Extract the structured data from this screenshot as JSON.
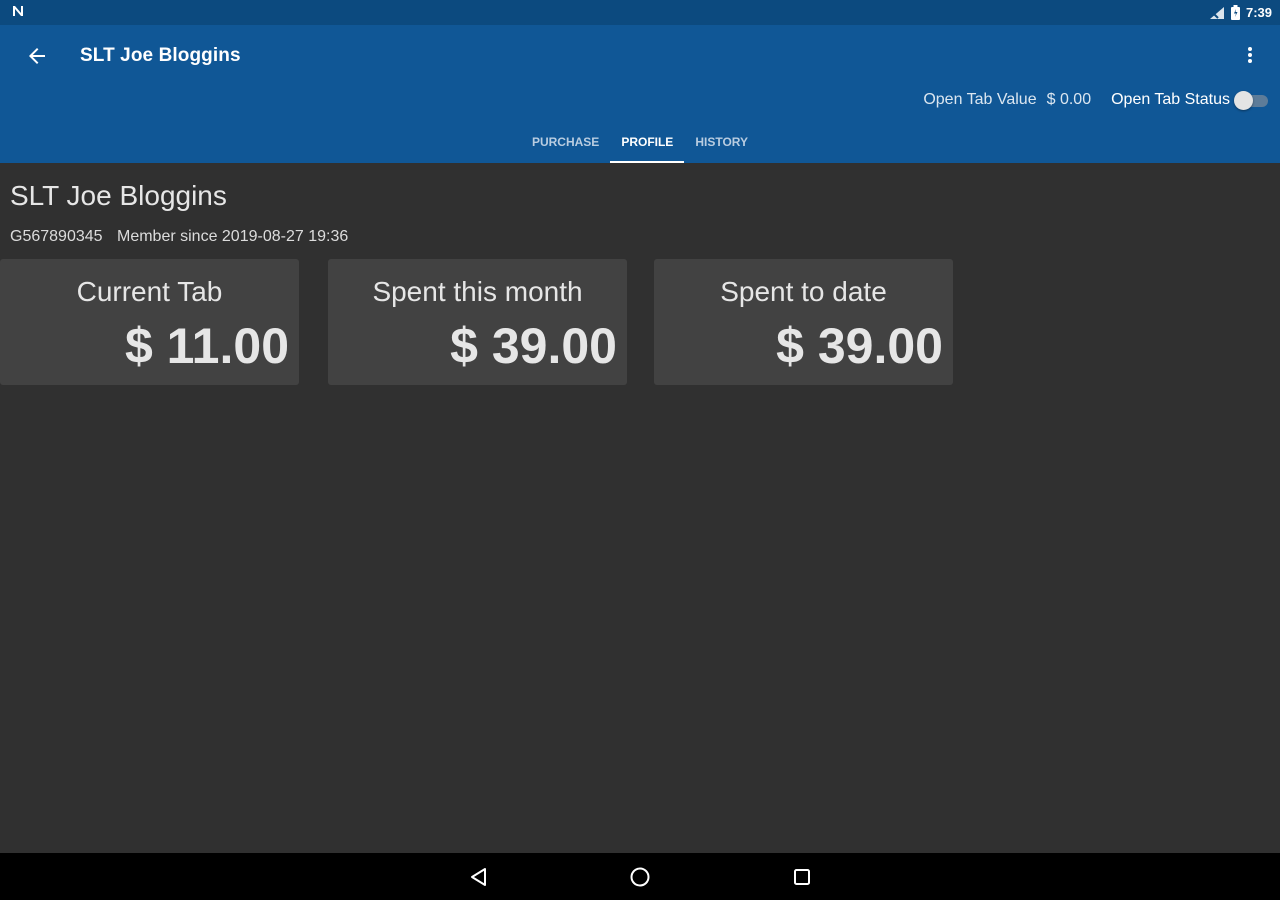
{
  "status_bar": {
    "left_icon": "notification-n-icon",
    "icons": [
      "signal-icon",
      "battery-icon"
    ],
    "time": "7:39"
  },
  "app_bar": {
    "title": "SLT Joe Bloggins",
    "back_icon": "arrow-left-icon",
    "overflow_icon": "more-vert-icon",
    "open_tab_value_label": "Open Tab Value",
    "open_tab_value_amount": "$ 0.00",
    "open_tab_status_label": "Open Tab Status",
    "open_tab_status_on": false,
    "tabs": [
      {
        "label": "PURCHASE",
        "active": false
      },
      {
        "label": "PROFILE",
        "active": true
      },
      {
        "label": "HISTORY",
        "active": false
      }
    ]
  },
  "profile": {
    "name": "SLT Joe Bloggins",
    "member_id": "G567890345",
    "member_since": "Member since 2019-08-27 19:36"
  },
  "cards": [
    {
      "label": "Current Tab",
      "value": "$ 11.00"
    },
    {
      "label": "Spent this month",
      "value": "$ 39.00"
    },
    {
      "label": "Spent to date",
      "value": "$ 39.00"
    }
  ],
  "nav_bar": {
    "icons": [
      "back-triangle-icon",
      "home-circle-icon",
      "recents-square-icon"
    ]
  },
  "colors": {
    "app_bar": "#105796",
    "status_bar": "#0c4a7f",
    "background": "#303030",
    "card": "#424242"
  }
}
